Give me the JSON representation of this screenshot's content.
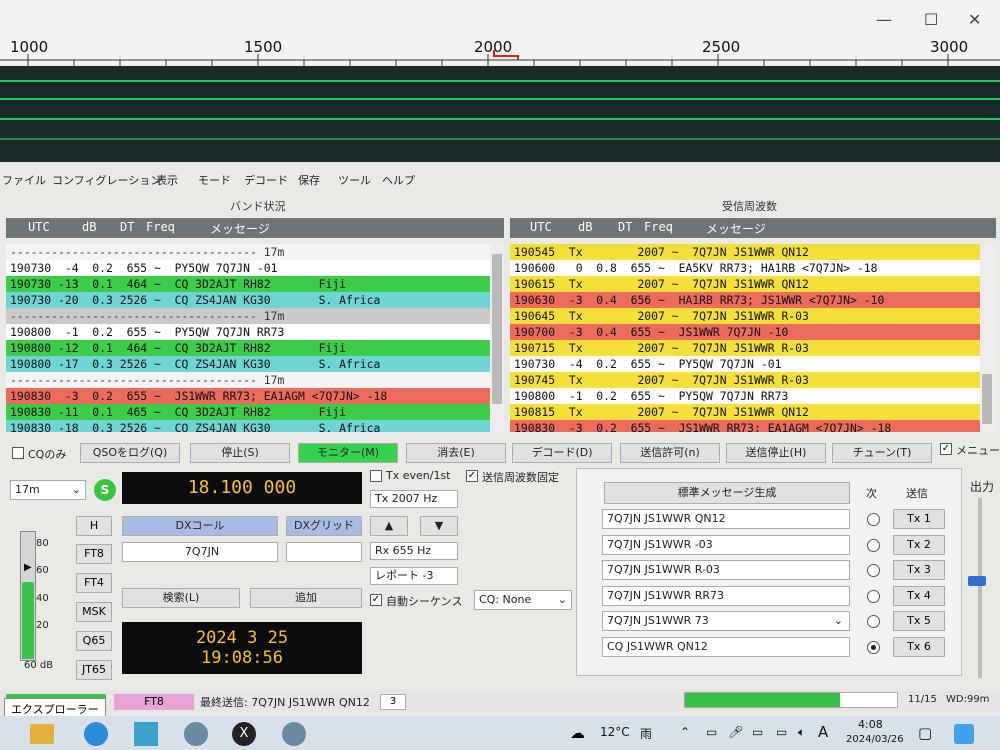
{
  "waterfall": {
    "window_controls": [
      "—",
      "☐",
      "✕"
    ],
    "freq_labels": [
      "1000",
      "1500",
      "2000",
      "2500",
      "3000"
    ]
  },
  "menu": [
    "ファイル",
    "コンフィグレーション",
    "表示",
    "モード",
    "デコード",
    "保存",
    "ツール",
    "ヘルプ"
  ],
  "band_activity": {
    "title": "バンド状況",
    "headers": [
      "UTC",
      "dB",
      "DT",
      "Freq",
      "メッセージ"
    ],
    "rows": [
      {
        "text": "------------------------------------ 17m",
        "style": "sep"
      },
      {
        "text": "190730  -4  0.2  655 ~  PY5QW 7Q7JN -01",
        "style": "white"
      },
      {
        "text": "190730 -13  0.1  464 ~  CQ 3D2AJT RH82       Fiji",
        "style": "green"
      },
      {
        "text": "190730 -20  0.3 2526 ~  CQ ZS4JAN KG30       S. Africa",
        "style": "cyan"
      },
      {
        "text": "------------------------------------ 17m",
        "style": "sepg"
      },
      {
        "text": "190800  -1  0.2  655 ~  PY5QW 7Q7JN RR73",
        "style": "white"
      },
      {
        "text": "190800 -12  0.1  464 ~  CQ 3D2AJT RH82       Fiji",
        "style": "green"
      },
      {
        "text": "190800 -17  0.3 2526 ~  CQ ZS4JAN KG30       S. Africa",
        "style": "cyan"
      },
      {
        "text": "------------------------------------ 17m",
        "style": "sep"
      },
      {
        "text": "190830  -3  0.2  655 ~  JS1WWR RR73; EA1AGM <7Q7JN> -18",
        "style": "red"
      },
      {
        "text": "190830 -11  0.1  465 ~  CQ 3D2AJT RH82       Fiji",
        "style": "green"
      },
      {
        "text": "190830 -18  0.3 2526 ~  CQ ZS4JAN KG30       S. Africa",
        "style": "cyan"
      }
    ]
  },
  "rx_frequency": {
    "title": "受信周波数",
    "headers": [
      "UTC",
      "dB",
      "DT",
      "Freq",
      "メッセージ"
    ],
    "rows": [
      {
        "text": "190545  Tx        2007 ~  7Q7JN JS1WWR QN12",
        "style": "yellow"
      },
      {
        "text": "190600   0  0.8  655 ~  EA5KV RR73; HA1RB <7Q7JN> -18",
        "style": "white"
      },
      {
        "text": "190615  Tx        2007 ~  7Q7JN JS1WWR QN12",
        "style": "yellow"
      },
      {
        "text": "190630  -3  0.4  656 ~  HA1RB RR73; JS1WWR <7Q7JN> -10",
        "style": "red"
      },
      {
        "text": "190645  Tx        2007 ~  7Q7JN JS1WWR R-03",
        "style": "yellow"
      },
      {
        "text": "190700  -3  0.4  655 ~  JS1WWR 7Q7JN -10",
        "style": "red"
      },
      {
        "text": "190715  Tx        2007 ~  7Q7JN JS1WWR R-03",
        "style": "yellow"
      },
      {
        "text": "190730  -4  0.2  655 ~  PY5QW 7Q7JN -01",
        "style": "white"
      },
      {
        "text": "190745  Tx        2007 ~  7Q7JN JS1WWR R-03",
        "style": "yellow"
      },
      {
        "text": "190800  -1  0.2  655 ~  PY5QW 7Q7JN RR73",
        "style": "white"
      },
      {
        "text": "190815  Tx        2007 ~  7Q7JN JS1WWR QN12",
        "style": "yellow"
      },
      {
        "text": "190830  -3  0.2  655 ~  JS1WWR RR73; EA1AGM <7Q7JN> -18",
        "style": "red"
      }
    ]
  },
  "buttons": {
    "cq_only": "CQのみ",
    "log_qso": "QSOをログ(Q)",
    "stop": "停止(S)",
    "monitor": "モニター(M)",
    "erase": "消去(E)",
    "decode": "デコード(D)",
    "enable_tx": "送信許可(n)",
    "halt_tx": "送信停止(H)",
    "tune": "チューン(T)",
    "menu": "メニュー"
  },
  "controls": {
    "band": "17m",
    "s_button": "S",
    "dial_freq": "18.100 000",
    "tx_even": "Tx even/1st",
    "hold_tx": "送信周波数固定",
    "tx_freq": "Tx  2007  Hz",
    "rx_freq": "Rx  655  Hz",
    "report": "レポート -3",
    "auto_seq": "自動シーケンス",
    "cq_mode": "CQ: None",
    "dx_call_label": "DXコール",
    "dx_grid_label": "DXグリッド",
    "dx_call": "7Q7JN",
    "dx_grid": "",
    "lookup": "検索(L)",
    "add": "追加",
    "date": "2024 3 25",
    "time": "19:08:56",
    "modes": [
      "H",
      "FT8",
      "FT4",
      "MSK",
      "Q65",
      "JT65"
    ],
    "meter_ticks": [
      "80",
      "60",
      "40",
      "20"
    ],
    "meter_db": "60 dB",
    "meter_level": 0.6,
    "up": "▲",
    "down": "▼"
  },
  "tx_panel": {
    "gen_button": "標準メッセージ生成",
    "next_label": "次",
    "send_label": "送信",
    "messages": [
      {
        "text": "7Q7JN JS1WWR QN12",
        "tx": "Tx 1",
        "selected": false
      },
      {
        "text": "7Q7JN JS1WWR -03",
        "tx": "Tx 2",
        "selected": false
      },
      {
        "text": "7Q7JN JS1WWR R-03",
        "tx": "Tx 3",
        "selected": false
      },
      {
        "text": "7Q7JN JS1WWR RR73",
        "tx": "Tx 4",
        "selected": false
      },
      {
        "text": "7Q7JN JS1WWR 73",
        "tx": "Tx 5",
        "selected": false
      },
      {
        "text": "CQ JS1WWR QN12",
        "tx": "Tx 6",
        "selected": true
      }
    ],
    "output_label": "出力"
  },
  "status": {
    "mode": "FT8",
    "last_tx": "最終送信: 7Q7JN JS1WWR QN12",
    "count": "3",
    "ratio": "11/15",
    "wd": "WD:99m",
    "tooltip": "エクスプローラー"
  },
  "taskbar": {
    "temp": "12°C",
    "weather": "雨",
    "time": "4:08",
    "date": "2024/03/26",
    "ime": "A"
  }
}
